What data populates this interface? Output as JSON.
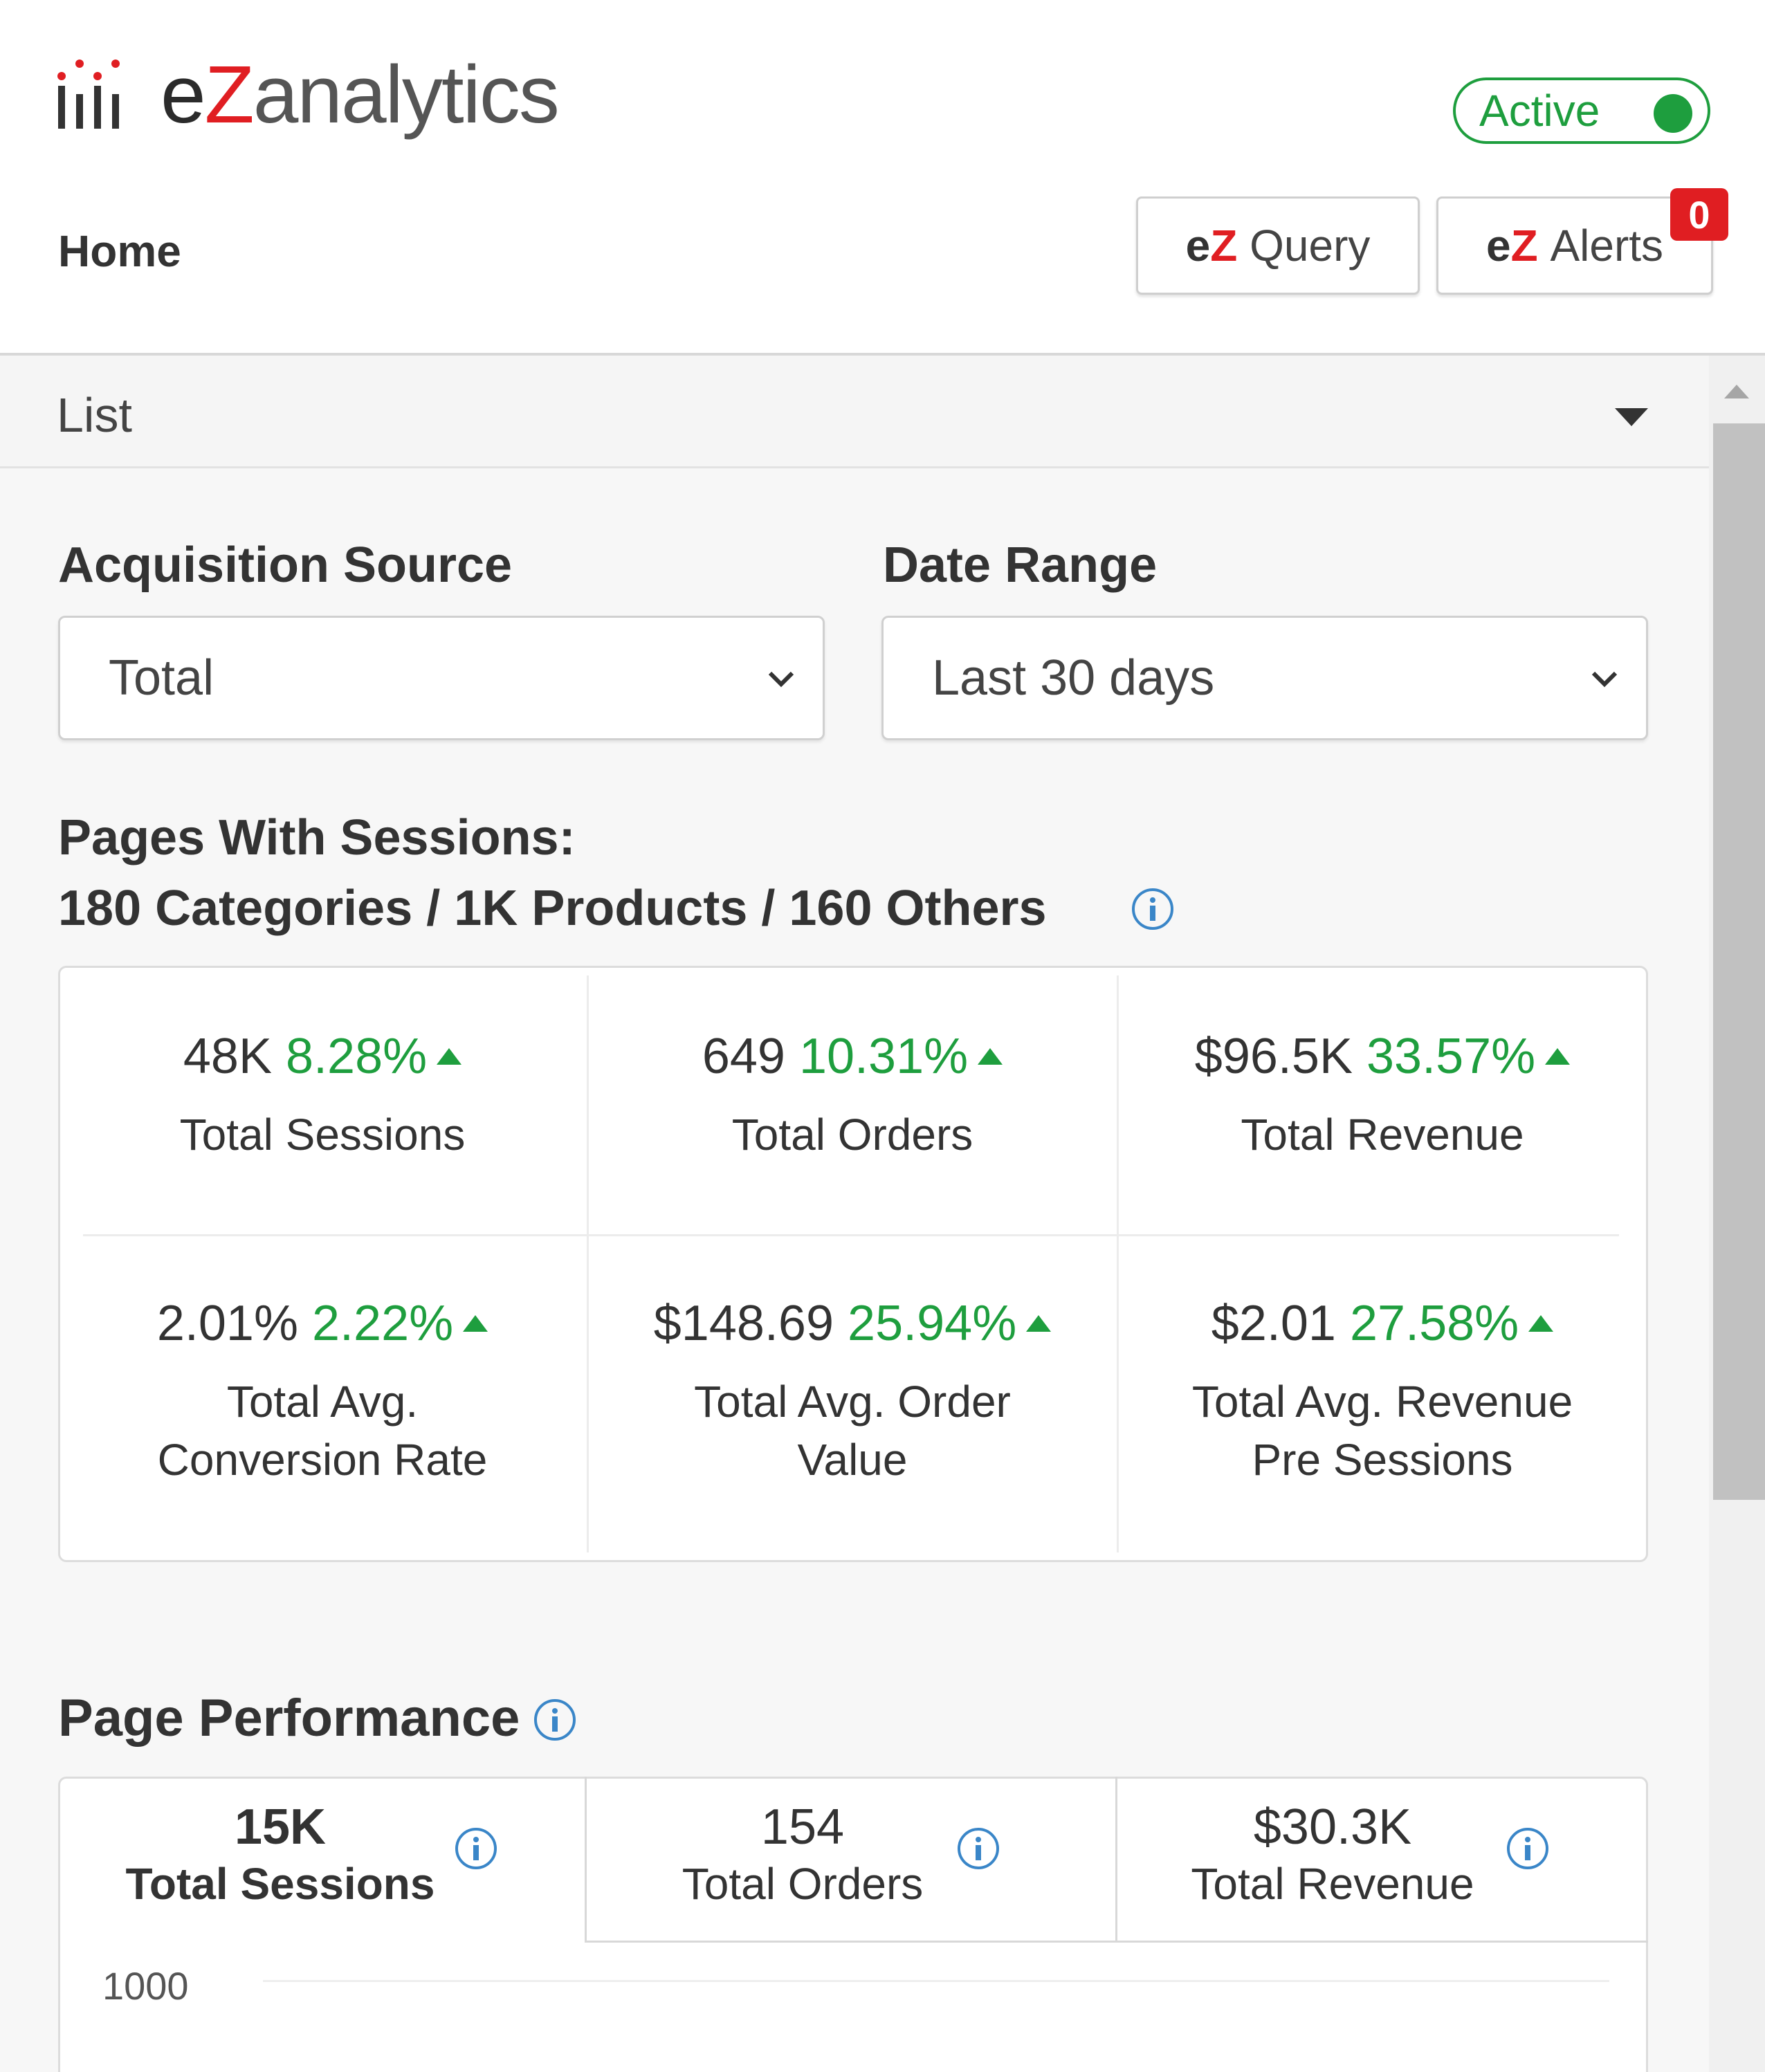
{
  "header": {
    "logo": {
      "prefix": "e",
      "z": "Z",
      "rest": "analytics"
    },
    "status_toggle": {
      "label": "Active",
      "on": true,
      "color": "#1e9e3e"
    },
    "nav_title": "Home",
    "query_button": {
      "prefix": "e",
      "z": "Z",
      "label": "Query"
    },
    "alerts_button": {
      "prefix": "e",
      "z": "Z",
      "label": "Alerts",
      "badge": "0"
    }
  },
  "view_selector": {
    "value": "List"
  },
  "filters": {
    "acquisition_source": {
      "label": "Acquisition Source",
      "value": "Total"
    },
    "date_range": {
      "label": "Date Range",
      "value": "Last 30 days"
    }
  },
  "pages_summary": {
    "line1": "Pages With Sessions:",
    "line2": "180 Categories / 1K Products / 160 Others"
  },
  "kpis": [
    {
      "value": "48K",
      "change": "8.28%",
      "label": "Total Sessions"
    },
    {
      "value": "649",
      "change": "10.31%",
      "label": "Total Orders"
    },
    {
      "value": "$96.5K",
      "change": "33.57%",
      "label": "Total Revenue"
    },
    {
      "value": "2.01%",
      "change": "2.22%",
      "label": "Total  Avg.\nConversion Rate"
    },
    {
      "value": "$148.69",
      "change": "25.94%",
      "label": "Total  Avg. Order\nValue"
    },
    {
      "value": "$2.01",
      "change": "27.58%",
      "label": "Total  Avg. Revenue\nPre Sessions"
    }
  ],
  "page_performance": {
    "title": "Page Performance",
    "tabs": [
      {
        "value": "15K",
        "label": "Total Sessions",
        "active": true
      },
      {
        "value": "154",
        "label": "Total Orders",
        "active": false
      },
      {
        "value": "$30.3K",
        "label": "Total Revenue",
        "active": false
      }
    ],
    "chart": {
      "y_ticks": [
        "1000"
      ]
    }
  },
  "colors": {
    "accent_green": "#1e9e3e",
    "brand_red": "#e01e22"
  }
}
